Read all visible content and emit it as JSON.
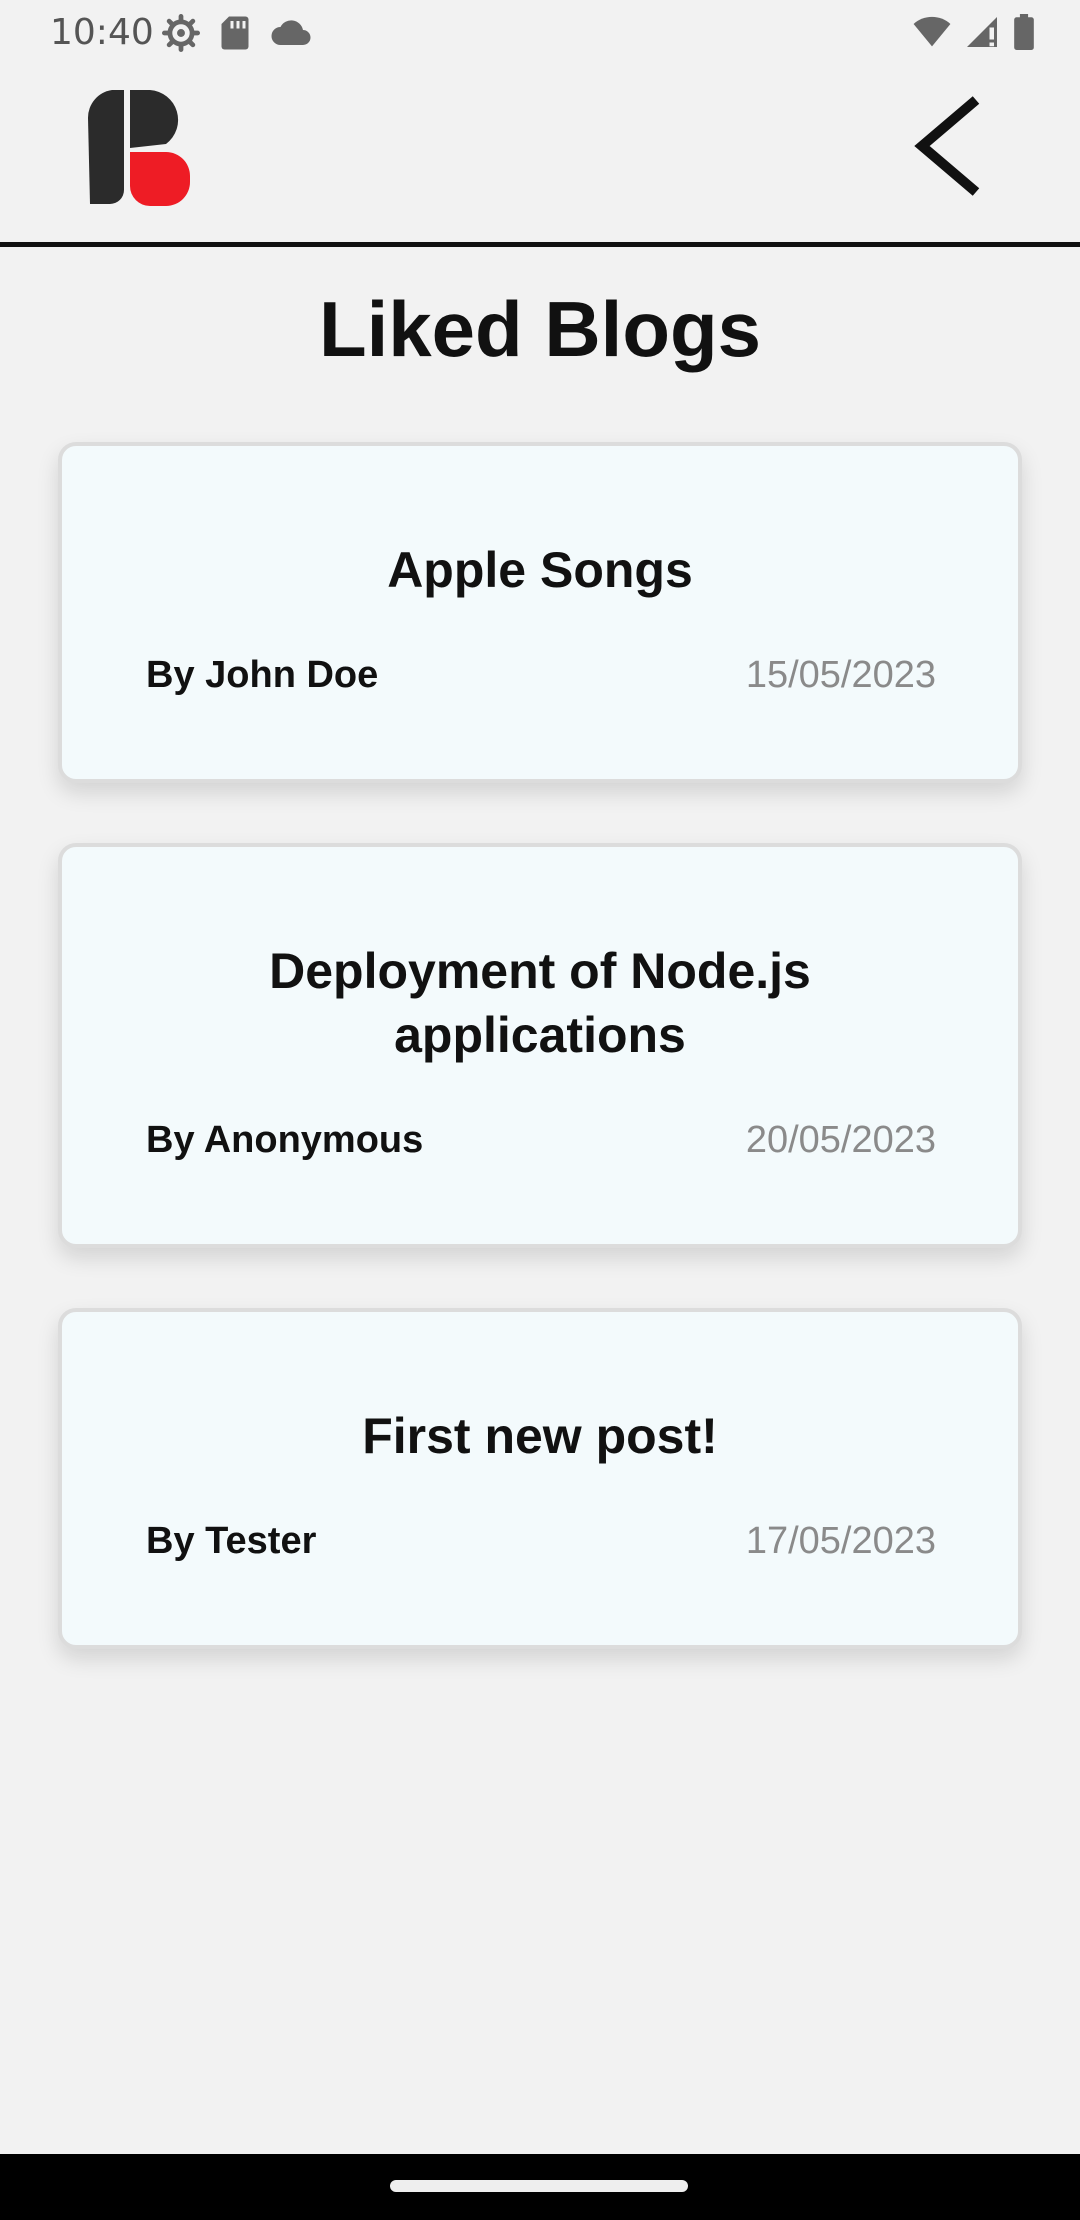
{
  "status_bar": {
    "time": "10:40",
    "left_icons": [
      "settings-icon",
      "sd-card-icon",
      "cloud-icon"
    ],
    "right_icons": [
      "wifi-icon",
      "cell-signal-icon",
      "battery-icon"
    ]
  },
  "header": {
    "logo_icon": "app-logo",
    "back_icon": "chevron-left-icon"
  },
  "page": {
    "title": "Liked Blogs"
  },
  "blogs": [
    {
      "title": "Apple Songs",
      "author": "By John Doe",
      "date": "15/05/2023"
    },
    {
      "title": "Deployment of Node.js applications",
      "author": "By Anonymous",
      "date": "20/05/2023"
    },
    {
      "title": "First new post!",
      "author": "By Tester",
      "date": "17/05/2023"
    }
  ],
  "colors": {
    "background": "#f2f2f2",
    "card_background": "#f3fafc",
    "logo_dark": "#2b2b2b",
    "logo_accent": "#ee1c25",
    "date_text": "#8a8a8a"
  }
}
